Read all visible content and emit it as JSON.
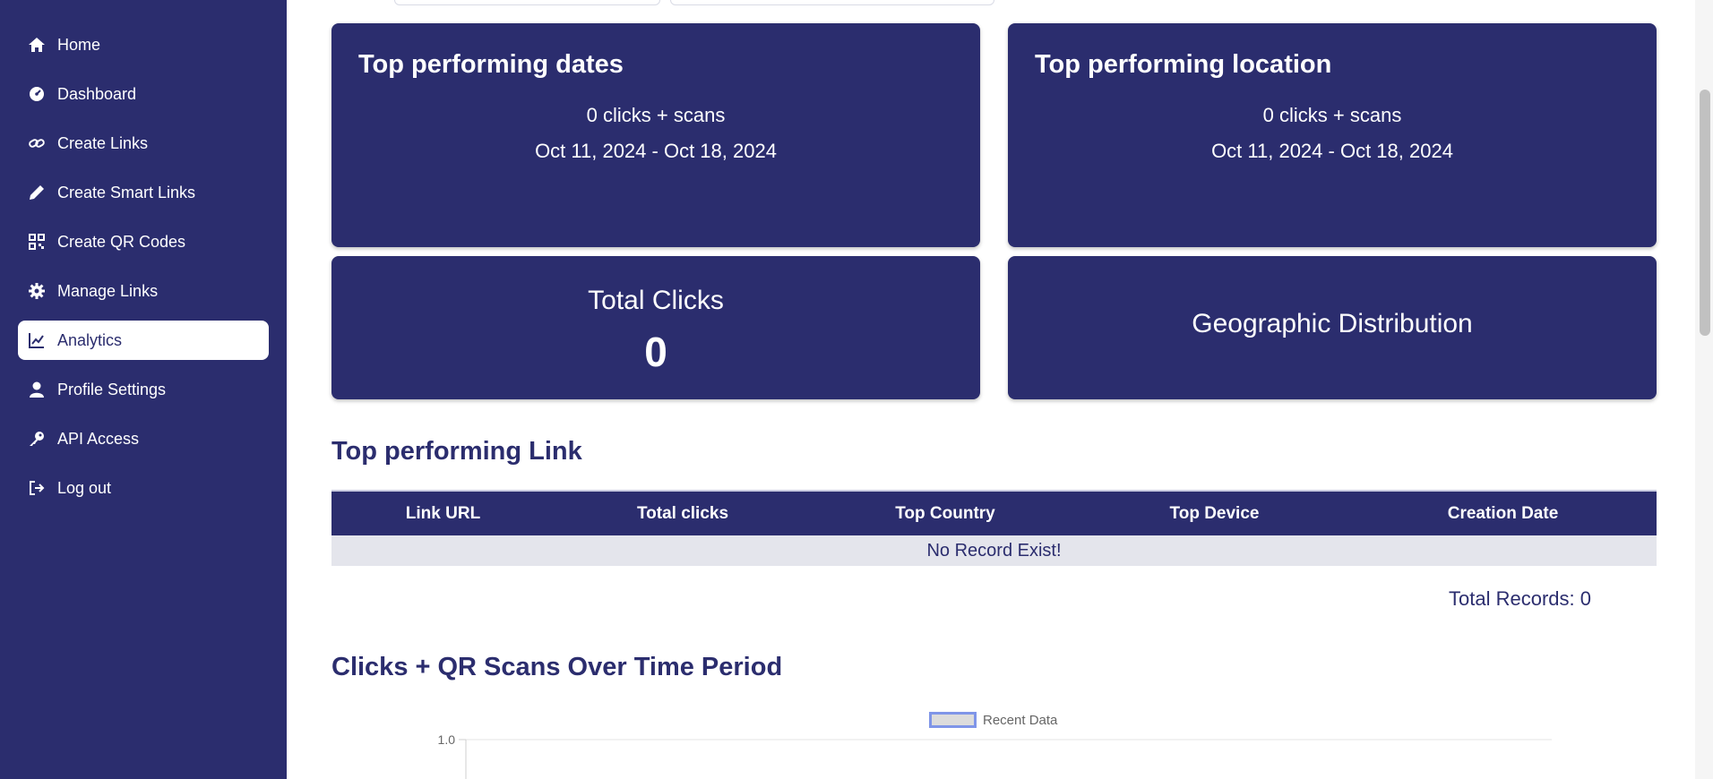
{
  "sidebar": {
    "items": [
      {
        "label": "Home",
        "icon": "home-icon"
      },
      {
        "label": "Dashboard",
        "icon": "gauge-icon"
      },
      {
        "label": "Create Links",
        "icon": "link-icon"
      },
      {
        "label": "Create Smart Links",
        "icon": "pencil-icon"
      },
      {
        "label": "Create QR Codes",
        "icon": "qr-code-icon"
      },
      {
        "label": "Manage Links",
        "icon": "gear-icon"
      },
      {
        "label": "Analytics",
        "icon": "chart-line-icon",
        "active": true
      },
      {
        "label": "Profile Settings",
        "icon": "user-icon"
      },
      {
        "label": "API Access",
        "icon": "key-icon"
      },
      {
        "label": "Log out",
        "icon": "logout-icon"
      }
    ]
  },
  "cards": {
    "top_dates": {
      "title": "Top performing dates",
      "clicks": "0 clicks + scans",
      "range": "Oct 11, 2024 - Oct 18, 2024"
    },
    "top_location": {
      "title": "Top performing location",
      "clicks": "0 clicks + scans",
      "range": "Oct 11, 2024 - Oct 18, 2024"
    },
    "total_clicks": {
      "title": "Total Clicks",
      "value": "0"
    },
    "geo": {
      "title": "Geographic Distribution"
    }
  },
  "top_link": {
    "title": "Top performing Link",
    "columns": [
      "Link URL",
      "Total clicks",
      "Top Country",
      "Top Device",
      "Creation Date"
    ],
    "empty_text": "No Record Exist!",
    "total_records": "Total Records: 0"
  },
  "chart_data": {
    "type": "line",
    "title": "Clicks + QR Scans Over Time Period",
    "series": [
      {
        "name": "Recent Data",
        "values": []
      }
    ],
    "y_ticks": [
      "1.0"
    ],
    "ylim": [
      0,
      1.0
    ],
    "legend": "top-center"
  },
  "colors": {
    "primary": "#2b2d6e",
    "row_bg": "#e4e5ec",
    "legend_border": "#7f95e8"
  }
}
